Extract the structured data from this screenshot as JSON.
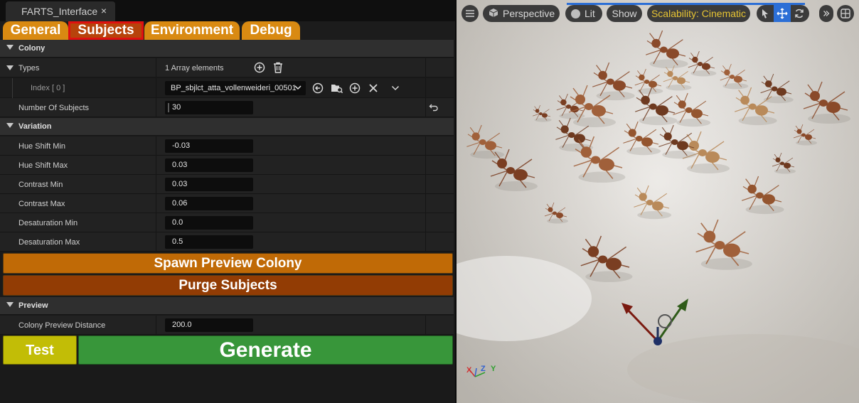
{
  "document_tab": {
    "title": "FARTS_Interface",
    "close_glyph": "×"
  },
  "category_tabs": [
    {
      "label": "General"
    },
    {
      "label": "Subjects"
    },
    {
      "label": "Environment"
    },
    {
      "label": "Debug"
    }
  ],
  "colony": {
    "header": "Colony",
    "types_label": "Types",
    "types_count": "1 Array elements",
    "index_label": "Index [ 0 ]",
    "index_value": "BP_sbjlct_atta_vollenweideri_00501",
    "number_of_subjects_label": "Number Of Subjects",
    "number_of_subjects_value": "30"
  },
  "variation": {
    "header": "Variation",
    "rows": [
      {
        "label": "Hue Shift Min",
        "value": "-0.03"
      },
      {
        "label": "Hue Shift Max",
        "value": "0.03"
      },
      {
        "label": "Contrast Min",
        "value": "0.03"
      },
      {
        "label": "Contrast Max",
        "value": "0.06"
      },
      {
        "label": "Desaturation Min",
        "value": "0.0"
      },
      {
        "label": "Desaturation Max",
        "value": "0.5"
      }
    ]
  },
  "buttons": {
    "spawn": "Spawn Preview Colony",
    "purge": "Purge Subjects",
    "test": "Test",
    "generate": "Generate"
  },
  "preview": {
    "header": "Preview",
    "distance_label": "Colony Preview Distance",
    "distance_value": "200.0"
  },
  "viewport_toolbar": {
    "perspective": "Perspective",
    "lit": "Lit",
    "show": "Show",
    "scalability": "Scalability: Cinematic"
  },
  "axis_indicator": {
    "x": "X",
    "z": "Z",
    "y": "Y"
  },
  "colors": {
    "tab_orange": "#d98a12",
    "tab_active": "#b7430b",
    "active_outline": "#e01010",
    "spawn_btn": "#c06a06",
    "purge_btn": "#923c04",
    "test_btn": "#c2bd06",
    "generate_btn": "#38963a",
    "scalability_text": "#e8c533"
  }
}
